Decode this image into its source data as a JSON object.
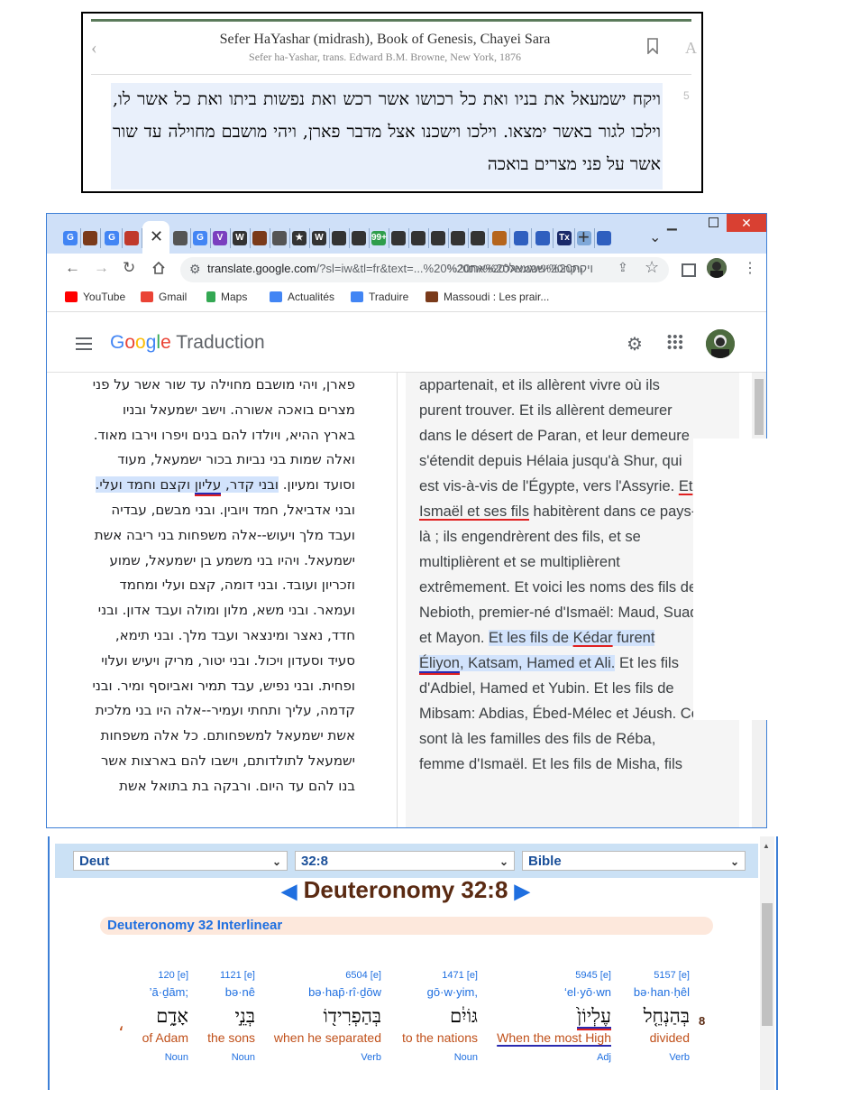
{
  "sefaria": {
    "title": "Sefer HaYashar (midrash), Book of Genesis, Chayei Sara",
    "subtitle": "Sefer ha-Yashar, trans. Edward B.M. Browne, New York, 1876",
    "hebrew": "ויקח ישמעאל את בניו ואת כל רכושו אשר רכש ואת נפשות ביתו ואת כל אשר לו, וילכו לגור באשר ימצאו. וילכו וישכנו אצל מדבר פארן, ויהי מושבם מחוילה עד שור אשר על פני מצרים בואכה",
    "verse_number": "5",
    "left_glyph": "‹",
    "right_glyph": "A"
  },
  "browser": {
    "tab_icon_letters": [
      "G",
      "",
      "G",
      "",
      "",
      "G",
      "V",
      "W",
      "",
      "",
      "★",
      "W",
      "",
      "",
      "99+",
      "",
      "",
      "",
      "",
      "",
      "",
      "",
      "",
      "Tx",
      "",
      ""
    ],
    "close_tab_glyph": "✕",
    "new_tab_glyph": "+",
    "url_host": "translate.google.com",
    "url_rest": "/?sl=iw&tl=fr&text=...%20ויקח%20ישמעאל%20את%20",
    "url_rtl_display": "ויקח%20ישמעאל%20את%20",
    "bookmarks": [
      {
        "label": "YouTube",
        "color": "#ff0000"
      },
      {
        "label": "Gmail",
        "color": "#ea4335"
      },
      {
        "label": "Maps",
        "color": "#34a853"
      },
      {
        "label": "Actualités",
        "color": "#4285f4"
      },
      {
        "label": "Traduire",
        "color": "#4285f4"
      },
      {
        "label": "Massoudi : Les prair...",
        "color": "#7a3a1a"
      }
    ]
  },
  "translate": {
    "logo_letters": [
      {
        "ch": "G",
        "color": "#4285f4"
      },
      {
        "ch": "o",
        "color": "#ea4335"
      },
      {
        "ch": "o",
        "color": "#fbbc05"
      },
      {
        "ch": "g",
        "color": "#4285f4"
      },
      {
        "ch": "l",
        "color": "#34a853"
      },
      {
        "ch": "e",
        "color": "#ea4335"
      }
    ],
    "logo_suffix": "Traduction",
    "source_before": "פארן, ויהי מושבם מחוילה עד שור אשר על פני מצרים בואכה אשורה. וישב ישמעאל ובניו בארץ ההיא, ויולדו להם בנים ויפרו וירבו מאוד. ואלה שמות בני נביות בכור ישמעאל, מעוד וסועד ומעיון. ",
    "source_hl_1": "ובני קדר, ",
    "source_hl_underlined": "עליון",
    "source_hl_2": " וקצם וחמד ועלי.",
    "source_after": " ובני אדביאל, חמד ויובין. ובני מבשם, עבדיה ועבד מלך ויעוש--אלה משפחות בני ריבה אשת ישמעאל. ויהיו בני משמע בן ישמעאל, שמוע וזכריון ועובד. ובני דומה, קצם ועלי ומחמד ועמאר. ובני משא, מלון ומולה ועבד אדון. ובני חדד, נאצר ומינצאר ועבד מלך. ובני תימא, סעיד וסעדון ויכול. ובני יטור, מריק ויעיש ועלוי ופחית. ובני נפיש, עבד תמיר ואביוסף ומיר. ובני קדמה, עליך ותחתי ועמיר--אלה היו בני מלכית אשת ישמעאל למשפחותם. כל אלה משפחות ישמעאל לתולדותם, וישבו להם בארצות אשר בנו להם עד היום. ורבקה בת בתואל אשת",
    "target_a": "appartenait, et ils allèrent vivre où ils purent trouver. Et ils allèrent demeurer dans le désert de Paran, et leur demeure s'étendit depuis Hélaia jusqu'à Shur, qui est vis-à-vis de l'Égypte, vers l'Assyrie. ",
    "target_ul_1": "Et Ismaël et ses fils",
    "target_b": " habitèrent dans ce pays-là ; ils engendrèrent des fils, et se multiplièrent et se multiplièrent extrêmement. Et voici les noms des fils de Nebioth, premier-né d'Ismaël: Maud, Suad et Mayon. ",
    "target_hl_1": "Et les fils de ",
    "target_hl_kedar": "Kédar",
    "target_hl_2": " furent ",
    "target_hl_eliyon": "Éliyon",
    "target_hl_3": ", Katsam, Hamed et Ali.",
    "target_c": " Et les fils d'Adbiel, Hamed et Yubin. Et les fils de Mibsam: Abdias, Ébed-Mélec et Jéush. Ce sont là les familles des fils de Réba, femme d'Ismaël. Et les fils de Misha, fils"
  },
  "biblehub": {
    "book_select": "Deut",
    "verse_select": "32:8",
    "version_select": "Bible",
    "title": "Deuteronomy 32:8",
    "subheading": "Deuteronomy 32 Interlinear",
    "verse_number": "8",
    "trailing_comma": "،",
    "words": [
      {
        "strong": "5157 [e]",
        "translit": "bə·han·ḥêl",
        "hebrew": "בְּהַנְחֵ֤ל",
        "english": "divided",
        "pos": "Verb"
      },
      {
        "strong": "5945 [e]",
        "translit": "‘el·yō·wn",
        "hebrew": "עֶלְיוֹן֙",
        "english": "When the most High",
        "pos": "Adj"
      },
      {
        "strong": "1471 [e]",
        "translit": "gō·w·yim,",
        "hebrew": "גּוֹיִ֔ם",
        "english": "to the nations",
        "pos": "Noun"
      },
      {
        "strong": "6504 [e]",
        "translit": "bə·hap̄·rî·ḏōw",
        "hebrew": "בְּהַפְרִיד֖וֹ",
        "english": "when he separated",
        "pos": "Verb"
      },
      {
        "strong": "1121 [e]",
        "translit": "bə·nê",
        "hebrew": "בְּנֵ֣י",
        "english": "the sons",
        "pos": "Noun"
      },
      {
        "strong": "120 [e]",
        "translit": "’ā·ḏām;",
        "hebrew": "אָדָ֑ם",
        "english": "of Adam",
        "pos": "Noun"
      }
    ]
  }
}
